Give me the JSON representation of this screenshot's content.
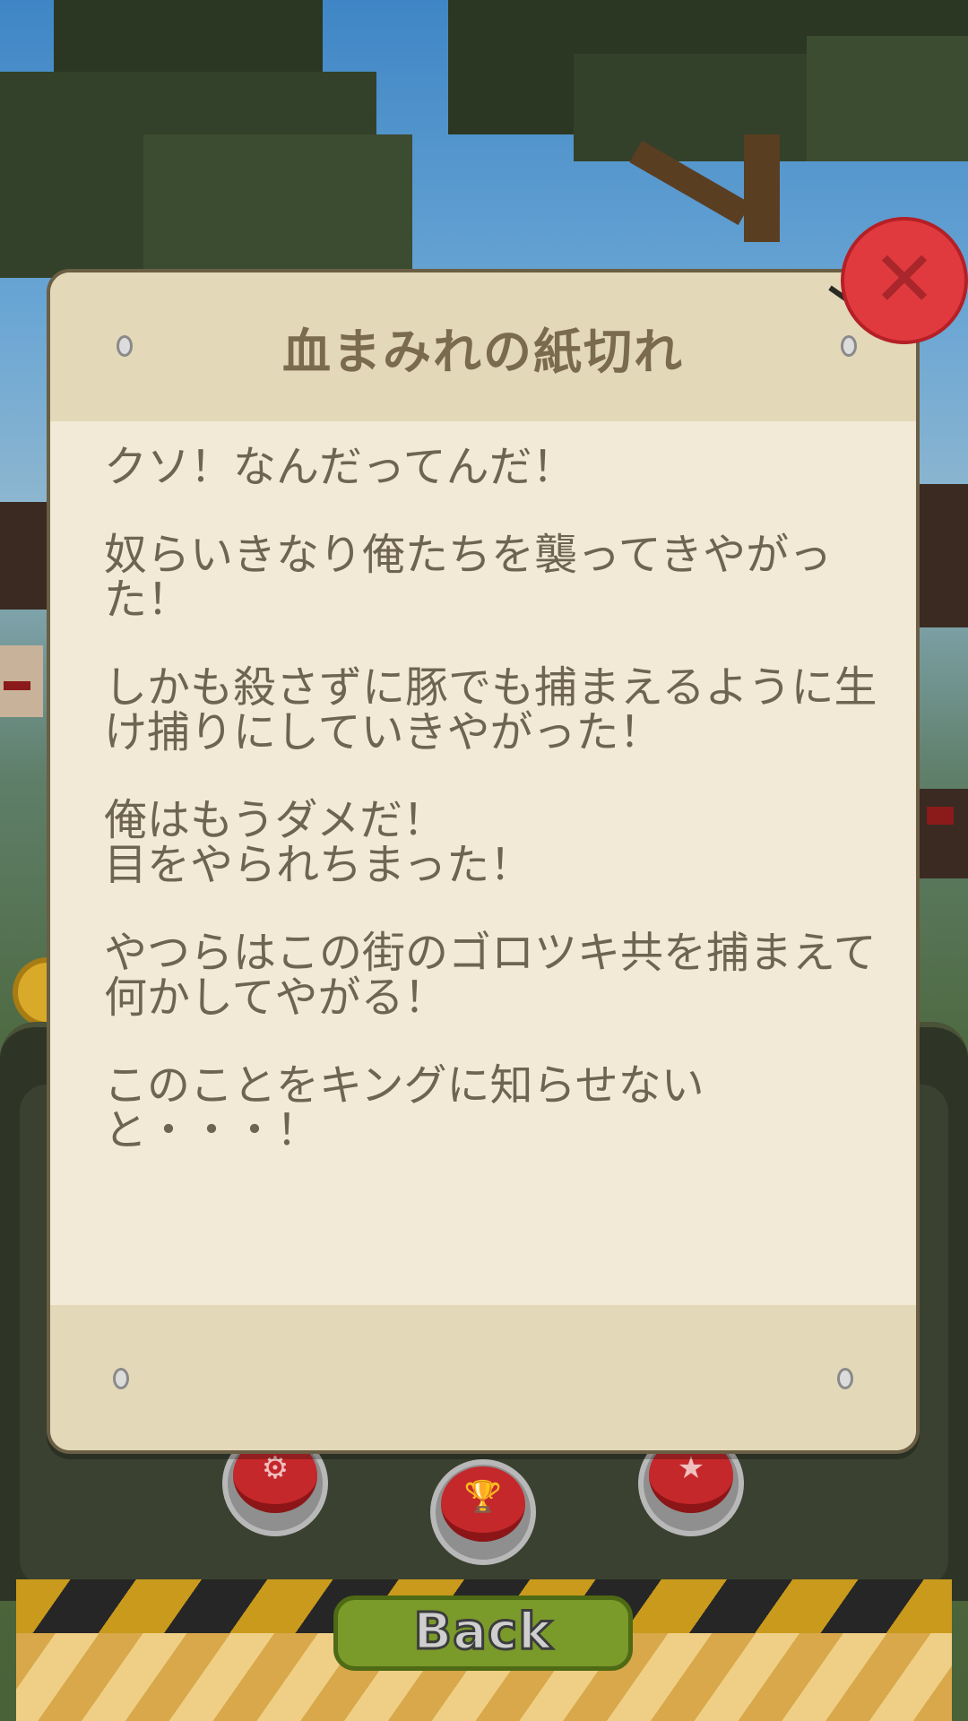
{
  "note": {
    "title": "血まみれの紙切れ",
    "paragraphs": [
      "クソ！なんだってんだ！",
      "奴らいきなり俺たちを襲ってきやがった！",
      "しかも殺さずに豚でも捕まえるように生け捕りにしていきやがった！",
      "俺はもうダメだ！\n目をやられちまった！",
      "やつらはこの街のゴロツキ共を捕まえて何かしてやがる！",
      "このことをキングに知らせないと・・・！"
    ]
  },
  "buttons": {
    "close_icon": "close-x-icon",
    "back_label": "Back",
    "settings_icon": "gear-icon",
    "trophy_icon": "trophy-icon",
    "star_icon": "star-icon"
  },
  "colors": {
    "paper": "#f2ead6",
    "paper_header": "#e3d8b8",
    "text": "#6e6450",
    "close_red": "#e03a3f",
    "back_green": "#7a9a2a"
  }
}
